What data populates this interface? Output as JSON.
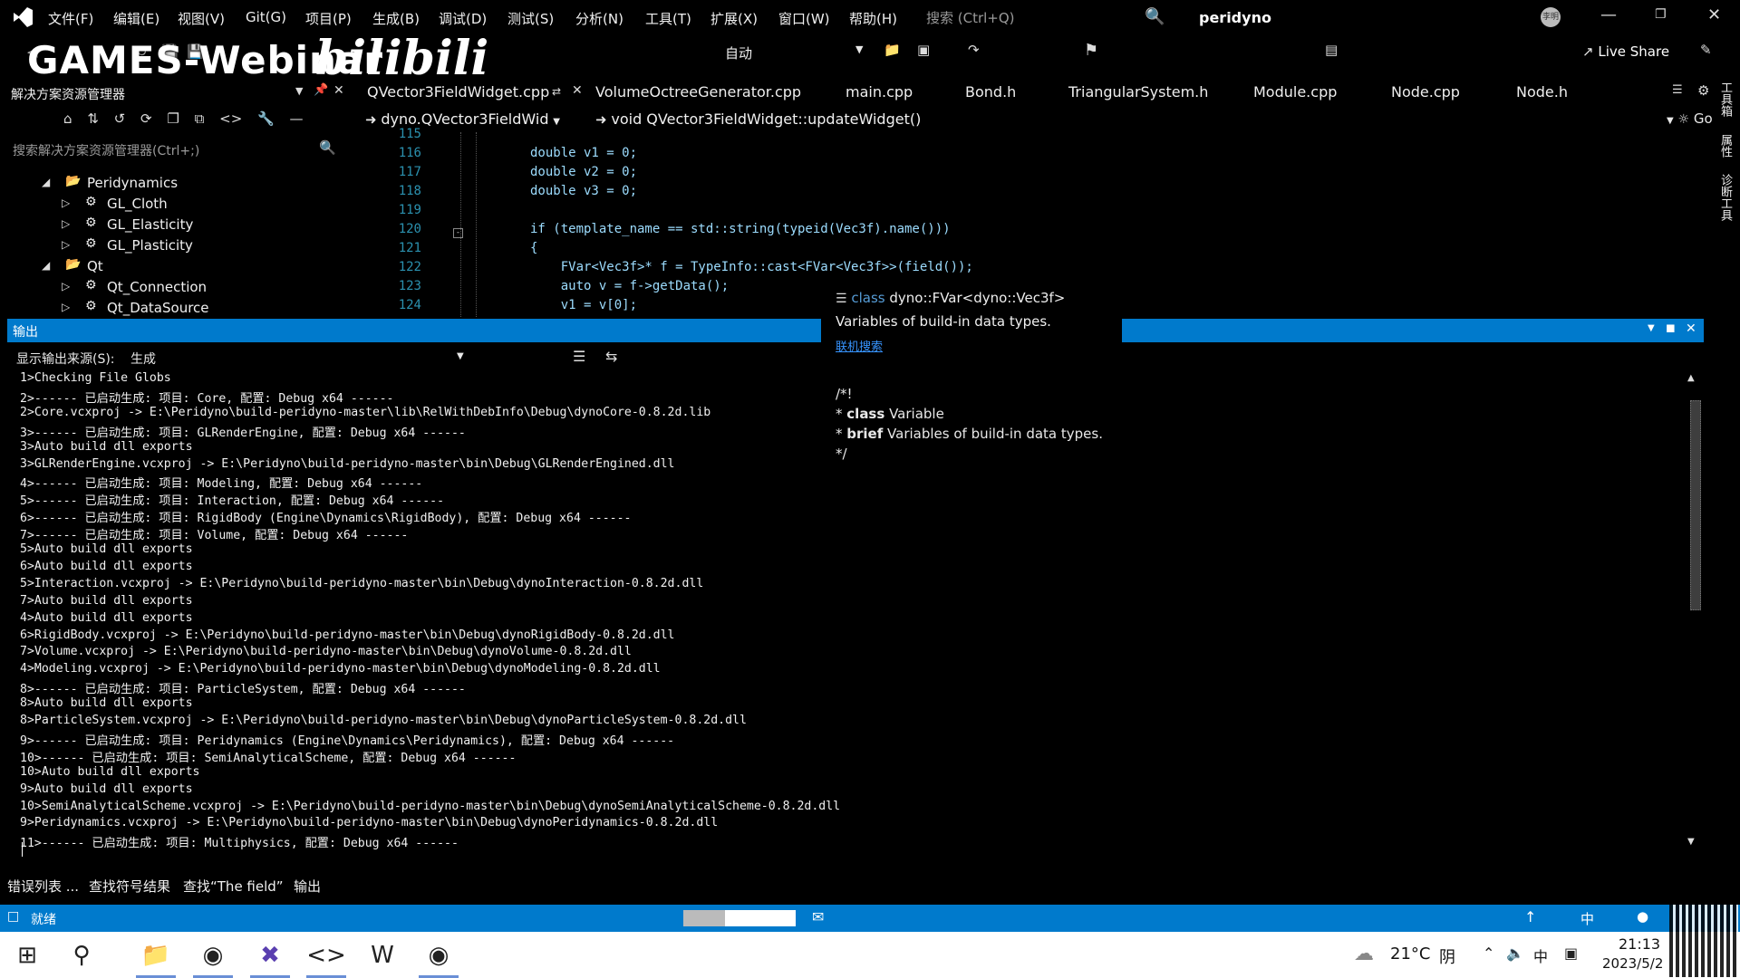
{
  "menubar": {
    "items": [
      "文件(F)",
      "编辑(E)",
      "视图(V)",
      "Git(G)",
      "项目(P)",
      "生成(B)",
      "调试(D)",
      "测试(S)",
      "分析(N)",
      "工具(T)",
      "扩展(X)",
      "窗口(W)",
      "帮助(H)"
    ],
    "search_placeholder": "搜索 (Ctrl+Q)",
    "solution_name": "peridyno",
    "avatar_text": "李明"
  },
  "toolbar": {
    "config_value": "自动",
    "live_share": "Live Share"
  },
  "watermark": {
    "text": "GAMES-Webinar",
    "logo": "bilibili"
  },
  "solution_explorer": {
    "title": "解决方案资源管理器",
    "search_placeholder": "搜索解决方案资源管理器(Ctrl+;)",
    "items": [
      {
        "label": "Peridynamics",
        "type": "folder",
        "expanded": true
      },
      {
        "label": "GL_Cloth",
        "type": "project"
      },
      {
        "label": "GL_Elasticity",
        "type": "project"
      },
      {
        "label": "GL_Plasticity",
        "type": "project"
      },
      {
        "label": "Qt",
        "type": "folder",
        "expanded": true
      },
      {
        "label": "Qt_Connection",
        "type": "project"
      },
      {
        "label": "Qt_DataSource",
        "type": "project"
      }
    ]
  },
  "editor": {
    "tabs": [
      "QVector3FieldWidget.cpp",
      "VolumeOctreeGenerator.cpp",
      "main.cpp",
      "Bond.h",
      "TriangularSystem.h",
      "Module.cpp",
      "Node.cpp",
      "Node.h"
    ],
    "scope_class": "dyno.QVector3FieldWid",
    "scope_method": "void QVector3FieldWidget::updateWidget()",
    "code_lines": [
      {
        "num": "115",
        "text": ""
      },
      {
        "num": "116",
        "text": "double v1 = 0;"
      },
      {
        "num": "117",
        "text": "double v2 = 0;"
      },
      {
        "num": "118",
        "text": "double v3 = 0;"
      },
      {
        "num": "119",
        "text": ""
      },
      {
        "num": "120",
        "text": "if (template_name == std::string(typeid(Vec3f).name()))"
      },
      {
        "num": "121",
        "text": "{"
      },
      {
        "num": "122",
        "text": "    FVar<Vec3f>* f = TypeInfo::cast<FVar<Vec3f>>(field());"
      },
      {
        "num": "123",
        "text": "    auto v = f->getData();"
      },
      {
        "num": "124",
        "text": "    v1 = v[0];"
      }
    ],
    "go_label": "Go"
  },
  "tooltip": {
    "signature_kw": "class",
    "signature": "dyno::FVar<dyno::Vec3f>",
    "summary": "Variables of build-in data types.",
    "online_search": "联机搜索",
    "doc_open": "/*!",
    "doc_line1_kw": "class",
    "doc_line1": "Variable",
    "doc_line2_kw": "brief",
    "doc_line2": "Variables of build-in data types.",
    "doc_close": "*/"
  },
  "output": {
    "title": "输出",
    "source_label": "显示输出来源(S):",
    "source_value": "生成",
    "lines": [
      "1>Checking File Globs",
      "2>------ 已启动生成: 项目: Core, 配置: Debug x64 ------",
      "2>Core.vcxproj -> E:\\Peridyno\\build-peridyno-master\\lib\\RelWithDebInfo\\Debug\\dynoCore-0.8.2d.lib",
      "3>------ 已启动生成: 项目: GLRenderEngine, 配置: Debug x64 ------",
      "3>Auto build dll exports",
      "3>GLRenderEngine.vcxproj -> E:\\Peridyno\\build-peridyno-master\\bin\\Debug\\GLRenderEngined.dll",
      "4>------ 已启动生成: 项目: Modeling, 配置: Debug x64 ------",
      "5>------ 已启动生成: 项目: Interaction, 配置: Debug x64 ------",
      "6>------ 已启动生成: 项目: RigidBody (Engine\\Dynamics\\RigidBody), 配置: Debug x64 ------",
      "7>------ 已启动生成: 项目: Volume, 配置: Debug x64 ------",
      "5>Auto build dll exports",
      "6>Auto build dll exports",
      "5>Interaction.vcxproj -> E:\\Peridyno\\build-peridyno-master\\bin\\Debug\\dynoInteraction-0.8.2d.dll",
      "7>Auto build dll exports",
      "4>Auto build dll exports",
      "6>RigidBody.vcxproj -> E:\\Peridyno\\build-peridyno-master\\bin\\Debug\\dynoRigidBody-0.8.2d.dll",
      "7>Volume.vcxproj -> E:\\Peridyno\\build-peridyno-master\\bin\\Debug\\dynoVolume-0.8.2d.dll",
      "4>Modeling.vcxproj -> E:\\Peridyno\\build-peridyno-master\\bin\\Debug\\dynoModeling-0.8.2d.dll",
      "8>------ 已启动生成: 项目: ParticleSystem, 配置: Debug x64 ------",
      "8>Auto build dll exports",
      "8>ParticleSystem.vcxproj -> E:\\Peridyno\\build-peridyno-master\\bin\\Debug\\dynoParticleSystem-0.8.2d.dll",
      "9>------ 已启动生成: 项目: Peridynamics (Engine\\Dynamics\\Peridynamics), 配置: Debug x64 ------",
      "10>------ 已启动生成: 项目: SemiAnalyticalScheme, 配置: Debug x64 ------",
      "10>Auto build dll exports",
      "9>Auto build dll exports",
      "10>SemiAnalyticalScheme.vcxproj -> E:\\Peridyno\\build-peridyno-master\\bin\\Debug\\dynoSemiAnalyticalScheme-0.8.2d.dll",
      "9>Peridynamics.vcxproj -> E:\\Peridyno\\build-peridyno-master\\bin\\Debug\\dynoPeridynamics-0.8.2d.dll",
      "11>------ 已启动生成: 项目: Multiphysics, 配置: Debug x64 ------"
    ]
  },
  "bottom_tabs": [
    "错误列表 ...",
    "查找符号结果",
    "查找“The field”",
    "输出"
  ],
  "statusbar": {
    "ready": "就绪"
  },
  "side_tabs": [
    "工具箱",
    "属性",
    "诊断工具"
  ],
  "taskbar": {
    "weather_temp": "21°C",
    "weather_text": "阴",
    "ime": "中",
    "time": "21:13",
    "date": "2023/5/2"
  },
  "colors": {
    "accent": "#007acc",
    "link": "#3794ff",
    "line_number": "#2b91af"
  }
}
